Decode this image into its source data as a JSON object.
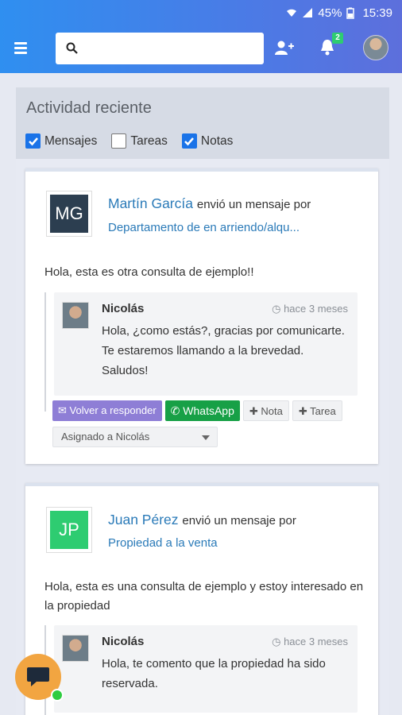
{
  "status_bar": {
    "battery": "45%",
    "time": "15:39"
  },
  "app_bar": {
    "search_placeholder": "",
    "notifications_count": "2"
  },
  "activity": {
    "title": "Actividad reciente",
    "filters": [
      {
        "label": "Mensajes",
        "checked": true
      },
      {
        "label": "Tareas",
        "checked": false
      },
      {
        "label": "Notas",
        "checked": true
      }
    ]
  },
  "feed": [
    {
      "initials": "MG",
      "initials_color": "#2c3e50",
      "author": "Martín García",
      "verb": "envió un mensaje por",
      "property": "Departamento de en arriendo/alqu...",
      "message": "Hola, esta es otra consulta de ejemplo!!",
      "reply": {
        "name": "Nicolás",
        "time": "hace 3 meses",
        "text": "Hola, ¿como estás?, gracias por comunicarte. Te estaremos llamando a la brevedad. Saludos!"
      },
      "actions": {
        "reply": "Volver a responder",
        "whatsapp": "WhatsApp",
        "note": "Nota",
        "task": "Tarea"
      },
      "assigned": "Asignado a Nicolás"
    },
    {
      "initials": "JP",
      "initials_color": "#2ecc71",
      "author": "Juan Pérez",
      "verb": "envió un mensaje por",
      "property": "Propiedad a la venta",
      "message": "Hola, esta es una consulta de ejemplo y estoy interesado en la propiedad",
      "reply": {
        "name": "Nicolás",
        "time": "hace 3 meses",
        "text": "Hola, te comento que la propiedad ha sido reservada."
      }
    }
  ]
}
